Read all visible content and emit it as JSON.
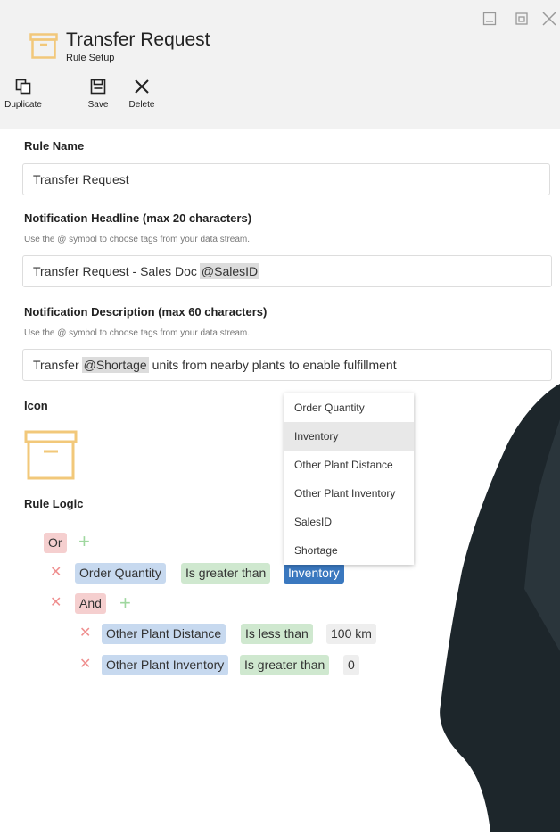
{
  "header": {
    "title": "Transfer Request",
    "subtitle": "Rule Setup",
    "toolbar": {
      "duplicate_label": "Duplicate",
      "save_label": "Save",
      "delete_label": "Delete"
    }
  },
  "form": {
    "rule_name": {
      "label": "Rule Name",
      "value": "Transfer Request"
    },
    "headline": {
      "label": "Notification Headline (max 20 characters)",
      "help": "Use the @ symbol to choose tags from your data stream.",
      "text": "Transfer Request - Sales Doc",
      "tag": "@SalesID"
    },
    "description": {
      "label": "Notification Description (max 60 characters)",
      "help": "Use the @ symbol to choose tags from your data stream.",
      "text_before": "Transfer",
      "tag": "@Shortage",
      "text_after": "units from nearby plants to enable fulfillment"
    },
    "icon_label": "Icon",
    "rule_logic_label": "Rule Logic"
  },
  "logic": {
    "root_op": "Or",
    "row1": {
      "field": "Order Quantity",
      "op": "Is greater than",
      "value": "Inventory"
    },
    "group_op": "And",
    "row2": {
      "field": "Other Plant Distance",
      "op": "Is less than",
      "value": "100 km"
    },
    "row3": {
      "field": "Other Plant Inventory",
      "op": "Is greater than",
      "value": "0"
    }
  },
  "dropdown": {
    "options": [
      "Order Quantity",
      "Inventory",
      "Other Plant Distance",
      "Other Plant Inventory",
      "SalesID",
      "Shortage"
    ],
    "selected": "Inventory"
  },
  "colors": {
    "accent_icon": "#f2c87a",
    "chip_active": "#3a78bf",
    "remove_icon": "#ef8f8f",
    "add_icon": "#9fd79f"
  },
  "icons": [
    "archive-box-icon",
    "minimize-icon",
    "restore-icon",
    "close-icon",
    "duplicate-icon",
    "save-icon",
    "delete-icon",
    "remove-icon",
    "add-icon"
  ]
}
